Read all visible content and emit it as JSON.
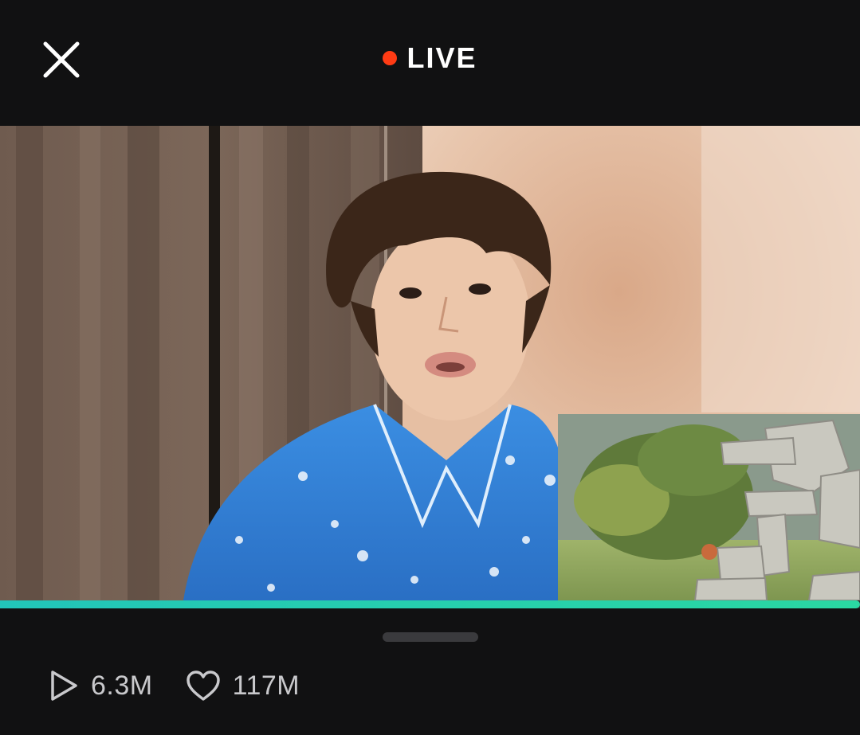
{
  "header": {
    "live_label": "LIVE",
    "live_dot_color": "#ff3b14",
    "close_icon": "close-icon"
  },
  "player": {
    "progress_fraction": 1.0,
    "progress_color": "#22c5b9"
  },
  "stats": {
    "plays": {
      "icon": "play-icon",
      "value": "6.3M"
    },
    "likes": {
      "icon": "heart-icon",
      "value": "117M"
    }
  }
}
